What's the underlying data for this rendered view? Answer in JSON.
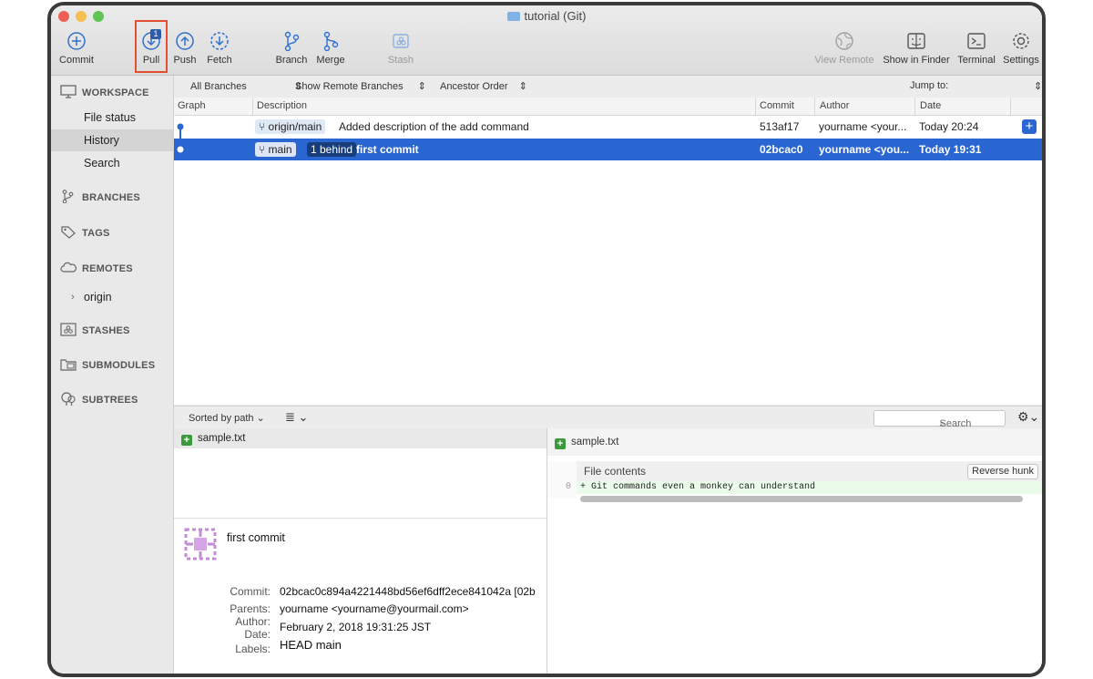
{
  "window": {
    "title": "tutorial (Git)"
  },
  "toolbar": {
    "commit": "Commit",
    "pull": "Pull",
    "pull_badge": "1",
    "push": "Push",
    "fetch": "Fetch",
    "branch": "Branch",
    "merge": "Merge",
    "stash": "Stash",
    "view_remote": "View Remote",
    "show_in_finder": "Show in Finder",
    "terminal": "Terminal",
    "settings": "Settings"
  },
  "sidebar": {
    "workspace": "WORKSPACE",
    "items": [
      "File status",
      "History",
      "Search"
    ],
    "branches": "BRANCHES",
    "tags": "TAGS",
    "remotes": "REMOTES",
    "remote_origin": "origin",
    "stashes": "STASHES",
    "submodules": "SUBMODULES",
    "subtrees": "SUBTREES"
  },
  "filters": {
    "all_branches": "All Branches",
    "show_remote": "Show Remote Branches",
    "order": "Ancestor Order",
    "jump_to": "Jump to:"
  },
  "columns": {
    "graph": "Graph",
    "description": "Description",
    "commit": "Commit",
    "author": "Author",
    "date": "Date"
  },
  "commits": [
    {
      "tag": "origin/main",
      "message": "Added description of the add command",
      "hash": "513af17",
      "author": "yourname <your...",
      "date": "Today 20:24"
    },
    {
      "tag": "main",
      "behind": "1 behind",
      "message": "first commit",
      "hash": "02bcac0",
      "author": "yourname <you...",
      "date": "Today 19:31"
    }
  ],
  "bottom": {
    "sort": "Sorted by path",
    "search_placeholder": "Search"
  },
  "file": {
    "name": "sample.txt"
  },
  "details": {
    "message": "first commit",
    "commit_label": "Commit:",
    "commit": "02bcac0c894a4221448bd56ef6dff2ece841042a [02b",
    "parents_label": "Parents:",
    "parents": "yourname <yourname@yourmail.com>",
    "author_label": "Author:",
    "date_label": "Date:",
    "date": "February 2, 2018 19:31:25 JST",
    "labels_label": "Labels:",
    "labels": "HEAD main"
  },
  "diff": {
    "file": "sample.txt",
    "hunk": "File contents",
    "reverse": "Reverse hunk",
    "line_no": "0",
    "line": "+ Git commands even a monkey can understand"
  },
  "colors": {
    "selection": "#2a66d1",
    "highlight": "#e4502f",
    "added": "#3b9a3b"
  }
}
